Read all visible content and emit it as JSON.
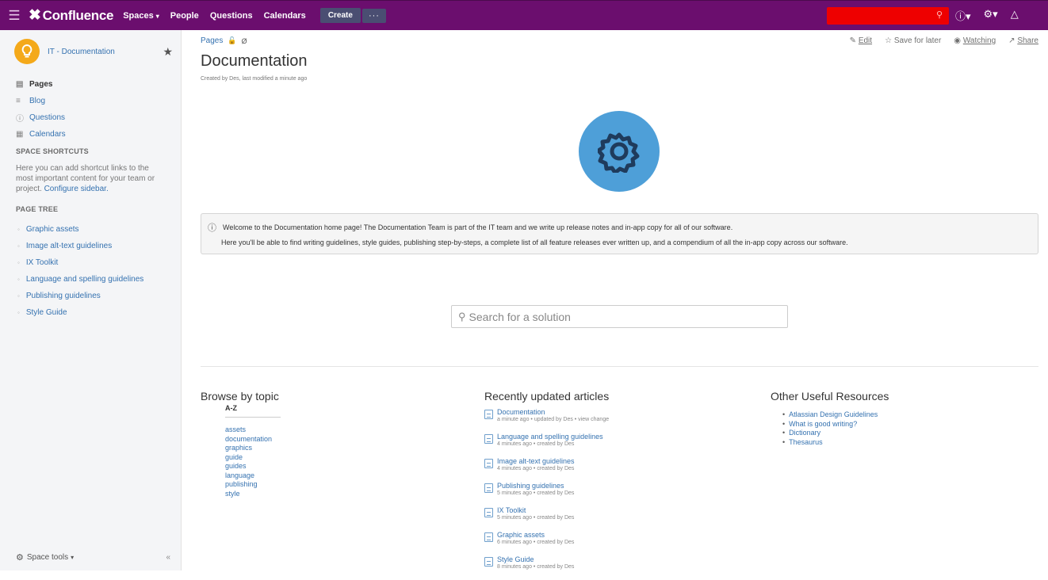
{
  "topnav": {
    "menu_icon": "hamburger-icon",
    "logo_text": "Confluence",
    "links": [
      {
        "label": "Spaces",
        "caret": true
      },
      {
        "label": "People",
        "caret": false
      },
      {
        "label": "Questions",
        "caret": false
      },
      {
        "label": "Calendars",
        "caret": false
      }
    ],
    "create_label": "Create",
    "more_label": "···",
    "search_color": "#e00000",
    "bar_color": "#6b0e6e"
  },
  "sidebar": {
    "space_name": "IT - Documentation",
    "nav": [
      {
        "label": "Pages",
        "icon": "pages-icon",
        "active": true
      },
      {
        "label": "Blog",
        "icon": "blog-icon",
        "active": false
      },
      {
        "label": "Questions",
        "icon": "questions-icon",
        "active": false
      },
      {
        "label": "Calendars",
        "icon": "calendar-icon",
        "active": false
      }
    ],
    "shortcuts_title": "SPACE SHORTCUTS",
    "shortcuts_text": "Here you can add shortcut links to the most important content for your team or project.",
    "configure_link": "Configure sidebar.",
    "page_tree_title": "PAGE TREE",
    "tree": [
      "Graphic assets",
      "Image alt-text guidelines",
      "IX Toolkit",
      "Language and spelling guidelines",
      "Publishing guidelines",
      "Style Guide"
    ],
    "space_tools": "Space tools",
    "collapse": "«"
  },
  "page": {
    "breadcrumb": "Pages",
    "actions": {
      "edit": "Edit",
      "save": "Save for later",
      "watching": "Watching",
      "share": "Share"
    },
    "title": "Documentation",
    "meta": "Created by Des, last modified a minute ago",
    "info_line1": "Welcome to the Documentation home page! The Documentation Team is part of the IT team and we write up release notes and in-app copy for all of our software.",
    "info_line2": "Here you'll be able to find writing guidelines, style guides, publishing step-by-steps, a complete list of all feature releases ever written up, and a compendium of all the in-app copy across our software.",
    "search_placeholder": "Search for a solution"
  },
  "browse": {
    "title": "Browse by topic",
    "az": "A-Z",
    "topics": [
      "assets",
      "documentation",
      "graphics",
      "guide",
      "guides",
      "language",
      "publishing",
      "style"
    ]
  },
  "recent": {
    "title": "Recently updated articles",
    "items": [
      {
        "title": "Documentation",
        "sub": "a minute ago • updated by Des • view change"
      },
      {
        "title": "Language and spelling guidelines",
        "sub": "4 minutes ago • created by Des"
      },
      {
        "title": "Image alt-text guidelines",
        "sub": "4 minutes ago • created by Des"
      },
      {
        "title": "Publishing guidelines",
        "sub": "5 minutes ago • created by Des"
      },
      {
        "title": "IX Toolkit",
        "sub": "5 minutes ago • created by Des"
      },
      {
        "title": "Graphic assets",
        "sub": "6 minutes ago • created by Des"
      },
      {
        "title": "Style Guide",
        "sub": "8 minutes ago • created by Des"
      }
    ]
  },
  "resources": {
    "title": "Other Useful Resources",
    "items": [
      "Atlassian Design Guidelines",
      "What is good writing?",
      "Dictionary",
      "Thesaurus"
    ]
  }
}
